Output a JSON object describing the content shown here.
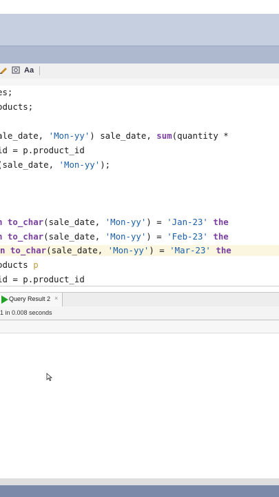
{
  "toolbar": {
    "icons": [
      "pencil-icon",
      "clear-icon",
      "format-icon"
    ]
  },
  "editor": {
    "lines": [
      {
        "plain": "es;"
      },
      {
        "plain": "oducts;"
      },
      {
        "plain": ""
      },
      {
        "p1": "ale_date, ",
        "s1": "'Mon-yy'",
        "p2": ") sale_date, ",
        "k1": "sum",
        "p3": "(quantity *"
      },
      {
        "plain": "id = p.product_id"
      },
      {
        "p1": "(sale_date, ",
        "s1": "'Mon-yy'",
        "p2": ");"
      },
      {
        "plain": ""
      },
      {
        "plain": ""
      },
      {
        "plain": ""
      },
      {
        "k0": "n ",
        "k1": "to_char",
        "p1": "(sale_date, ",
        "s1": "'Mon-yy'",
        "p2": ") = ",
        "s2": "'Jan-23'",
        "p3": " ",
        "k2": "the"
      },
      {
        "k0": "n ",
        "k1": "to_char",
        "p1": "(sale_date, ",
        "s1": "'Mon-yy'",
        "p2": ") = ",
        "s2": "'Feb-23'",
        "p3": " ",
        "k2": "the"
      },
      {
        "k0": "n ",
        "k1": "to_char",
        "p1": "(sale_date, ",
        "s1": "'Mon-yy'",
        "p2": ") = ",
        "s2": "'Mar-23'",
        "p3": " ",
        "k2": "the"
      },
      {
        "p1": "oducts ",
        "s1": "p"
      },
      {
        "plain": "id = p.product_id"
      }
    ]
  },
  "results": {
    "tab_label": "Query Result 2",
    "tab_close": "×",
    "status": "1 in 0.008 seconds"
  },
  "colors": {
    "keyword": "#7a3fa0",
    "string": "#1c5fa8",
    "run": "#22a22a"
  }
}
